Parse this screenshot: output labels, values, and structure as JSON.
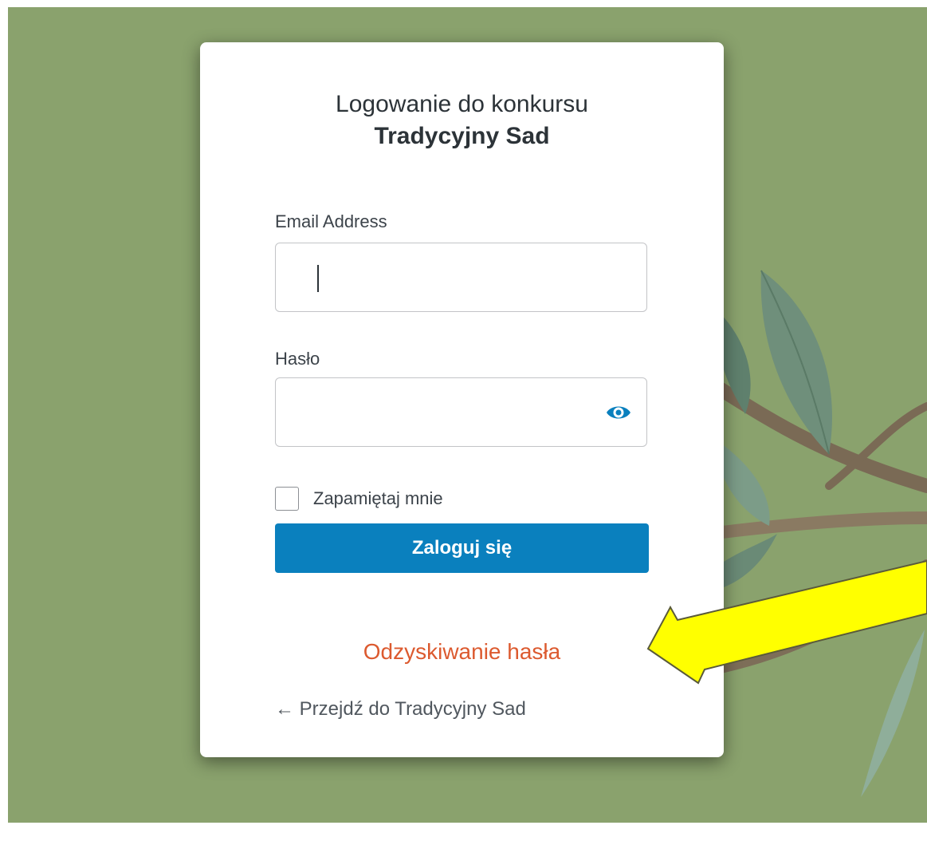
{
  "page": {
    "background_color": "#8aa26d",
    "accent_color": "#0a80be",
    "link_color": "#dc5a2f"
  },
  "login": {
    "heading_line1": "Logowanie do konkursu",
    "heading_line2": "Tradycyjny Sad",
    "email_label": "Email Address",
    "email_value": "",
    "password_label": "Hasło",
    "password_value": "",
    "password_toggle_icon": "eye-icon",
    "remember_label": "Zapamiętaj mnie",
    "remember_checked": false,
    "submit_label": "Zaloguj się",
    "recover_link": "Odzyskiwanie hasła",
    "back_link": "← Przejdź do Tradycyjny Sad"
  },
  "annotation": {
    "arrow_color": "#ffff00",
    "arrow_icon": "arrow-pointer-icon"
  }
}
